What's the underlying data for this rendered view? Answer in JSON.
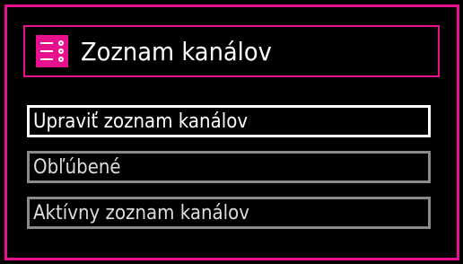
{
  "header": {
    "title": "Zoznam kanálov",
    "icon": "channel-list-icon"
  },
  "menu": {
    "items": [
      {
        "label": "Upraviť zoznam kanálov",
        "selected": true
      },
      {
        "label": "Obľúbené",
        "selected": false
      },
      {
        "label": "Aktívny zoznam kanálov",
        "selected": false
      }
    ]
  },
  "colors": {
    "accent": "#e8108c",
    "background": "#000000",
    "selected_border": "#ffffff",
    "item_border": "#8a8a8a"
  }
}
